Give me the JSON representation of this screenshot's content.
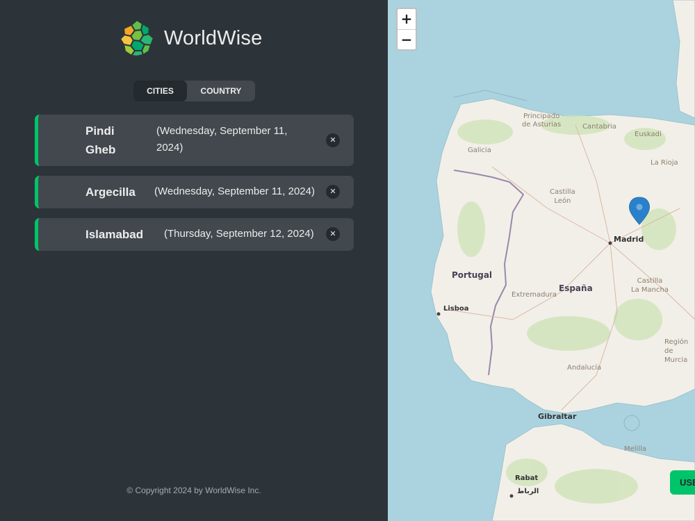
{
  "app": {
    "name": "WorldWise"
  },
  "tabs": [
    {
      "label": "Cities",
      "active": true
    },
    {
      "label": "Country",
      "active": false
    }
  ],
  "cities": [
    {
      "name_line1": "Pindi",
      "name_line2": "Gheb",
      "date_line1": "(Wednesday, September 11,",
      "date_line2": "2024)"
    },
    {
      "name": "Argecilla",
      "date": "(Wednesday, September 11, 2024)"
    },
    {
      "name": "Islamabad",
      "date": "(Thursday, September 12, 2024)"
    }
  ],
  "footer": {
    "copyright": "© Copyright 2024 by WorldWise Inc."
  },
  "map": {
    "zoom_in": "+",
    "zoom_out": "−",
    "labels": {
      "asturias_1": "Principado",
      "asturias_2": "de Asturias",
      "cantabria": "Cantabria",
      "euskadi": "Euskadi",
      "galicia": "Galicia",
      "la_rioja": "La Rioja",
      "castilla_leon_1": "Castilla",
      "castilla_leon_2": "León",
      "madrid": "Madrid",
      "portugal": "Portugal",
      "espana": "España",
      "extremadura": "Extremadura",
      "castilla_mancha_1": "Castilla",
      "castilla_mancha_2": "La Mancha",
      "lisboa": "Lisboa",
      "region_murcia_1": "Región de",
      "region_murcia_2": "Murcia",
      "andalucia": "Andalucía",
      "gibraltar": "Gibraltar",
      "rabat": "Rabat",
      "rabat_ar": "الرباط",
      "melilla": "Melilla"
    },
    "geolocate_label": "USE"
  },
  "colors": {
    "accent": "#00c46a",
    "sidebar": "#2d3439",
    "card": "#42484d",
    "dark": "#242a2e",
    "sea": "#aad3df",
    "land": "#f2efe9"
  }
}
